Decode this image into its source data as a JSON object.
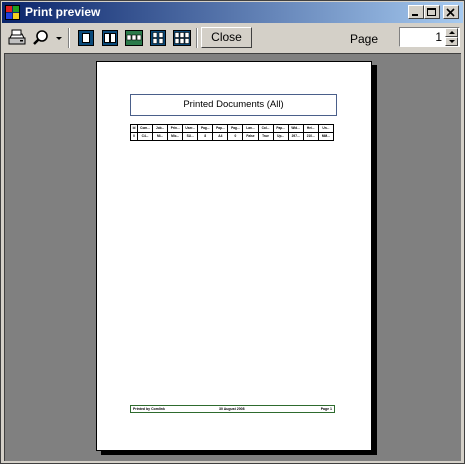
{
  "window": {
    "title": "Print preview",
    "colors": {
      "title_start": "#0a246a",
      "title_end": "#a6caf0",
      "preview_bg": "#808080"
    }
  },
  "toolbar": {
    "buttons": [
      {
        "name": "print-button",
        "icon": "printer-icon"
      },
      {
        "name": "zoom-button",
        "icon": "magnifier-icon"
      },
      {
        "name": "zoom-dropdown",
        "icon": "dropdown-arrow-icon"
      },
      {
        "name": "one-page-button",
        "icon": "one-page-icon"
      },
      {
        "name": "two-pages-button",
        "icon": "two-pages-icon"
      },
      {
        "name": "three-pages-button",
        "icon": "three-pages-icon"
      },
      {
        "name": "four-pages-button",
        "icon": "four-pages-icon"
      },
      {
        "name": "six-pages-button",
        "icon": "six-pages-icon"
      }
    ],
    "close_label": "Close",
    "page_label": "Page",
    "page_value": "1"
  },
  "document": {
    "report_title": "Printed Documents (All)",
    "table": {
      "headers": [
        "Id",
        "Com...",
        "Job...",
        "Prin...",
        "User...",
        "Pag...",
        "Pap...",
        "Pag...",
        "Lan...",
        "Col...",
        "Pap...",
        "Wid...",
        "Hei...",
        "Un..."
      ],
      "rows": [
        [
          "0",
          "C4...",
          "Mi...",
          "Mic...",
          "SU...",
          "8",
          "A4",
          "0",
          "False",
          "True",
          "Up...",
          "297...",
          "210...",
          "MM..."
        ]
      ]
    },
    "footer": {
      "left": "Printed by Comlink",
      "center": "30 August 2008",
      "right": "Page 1"
    }
  }
}
